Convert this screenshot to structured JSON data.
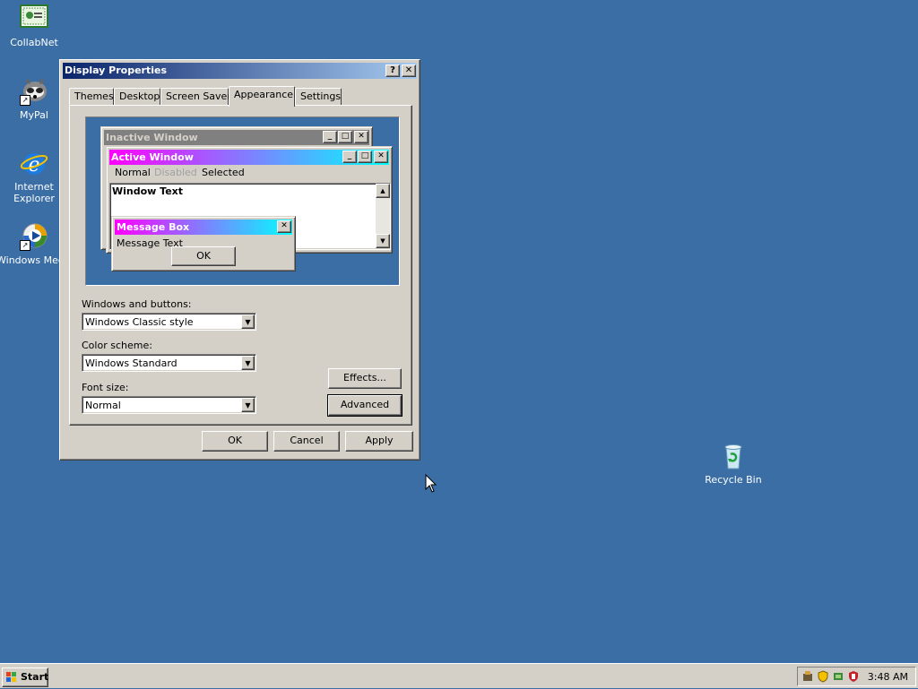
{
  "desktop": {
    "icons": [
      {
        "label": "CollabNet"
      },
      {
        "label": "MyPal"
      },
      {
        "label": "Internet Explorer"
      },
      {
        "label": "Windows Media Player"
      },
      {
        "label": "Recycle Bin"
      }
    ]
  },
  "dialog": {
    "title": "Display Properties",
    "title_buttons": {
      "help": "?",
      "close": "✕"
    },
    "tabs": [
      {
        "label": "Themes"
      },
      {
        "label": "Desktop"
      },
      {
        "label": "Screen Saver"
      },
      {
        "label": "Appearance",
        "active": true
      },
      {
        "label": "Settings"
      }
    ],
    "preview": {
      "inactive_title": "Inactive Window",
      "active_title": "Active Window",
      "menu": {
        "normal": "Normal",
        "disabled": "Disabled",
        "selected": "Selected"
      },
      "window_text": "Window Text",
      "message_box_title": "Message Box",
      "message_text": "Message Text",
      "ok": "OK"
    },
    "windows_buttons": {
      "label": "Windows and buttons:",
      "value": "Windows Classic style"
    },
    "color_scheme": {
      "label": "Color scheme:",
      "value": "Windows Standard"
    },
    "font_size": {
      "label": "Font size:",
      "value": "Normal"
    },
    "effects_button": "Effects...",
    "advanced_button": "Advanced",
    "ok_button": "OK",
    "cancel_button": "Cancel",
    "apply_button": "Apply"
  },
  "taskbar": {
    "start_label": "Start",
    "clock": "3:48 AM"
  },
  "colors": {
    "desktop": "#3a6ea5",
    "title_active_start": "#0a246a",
    "title_active_end": "#a6caf0",
    "preview_active_start": "#ff00ff",
    "preview_active_end": "#00ffff"
  }
}
